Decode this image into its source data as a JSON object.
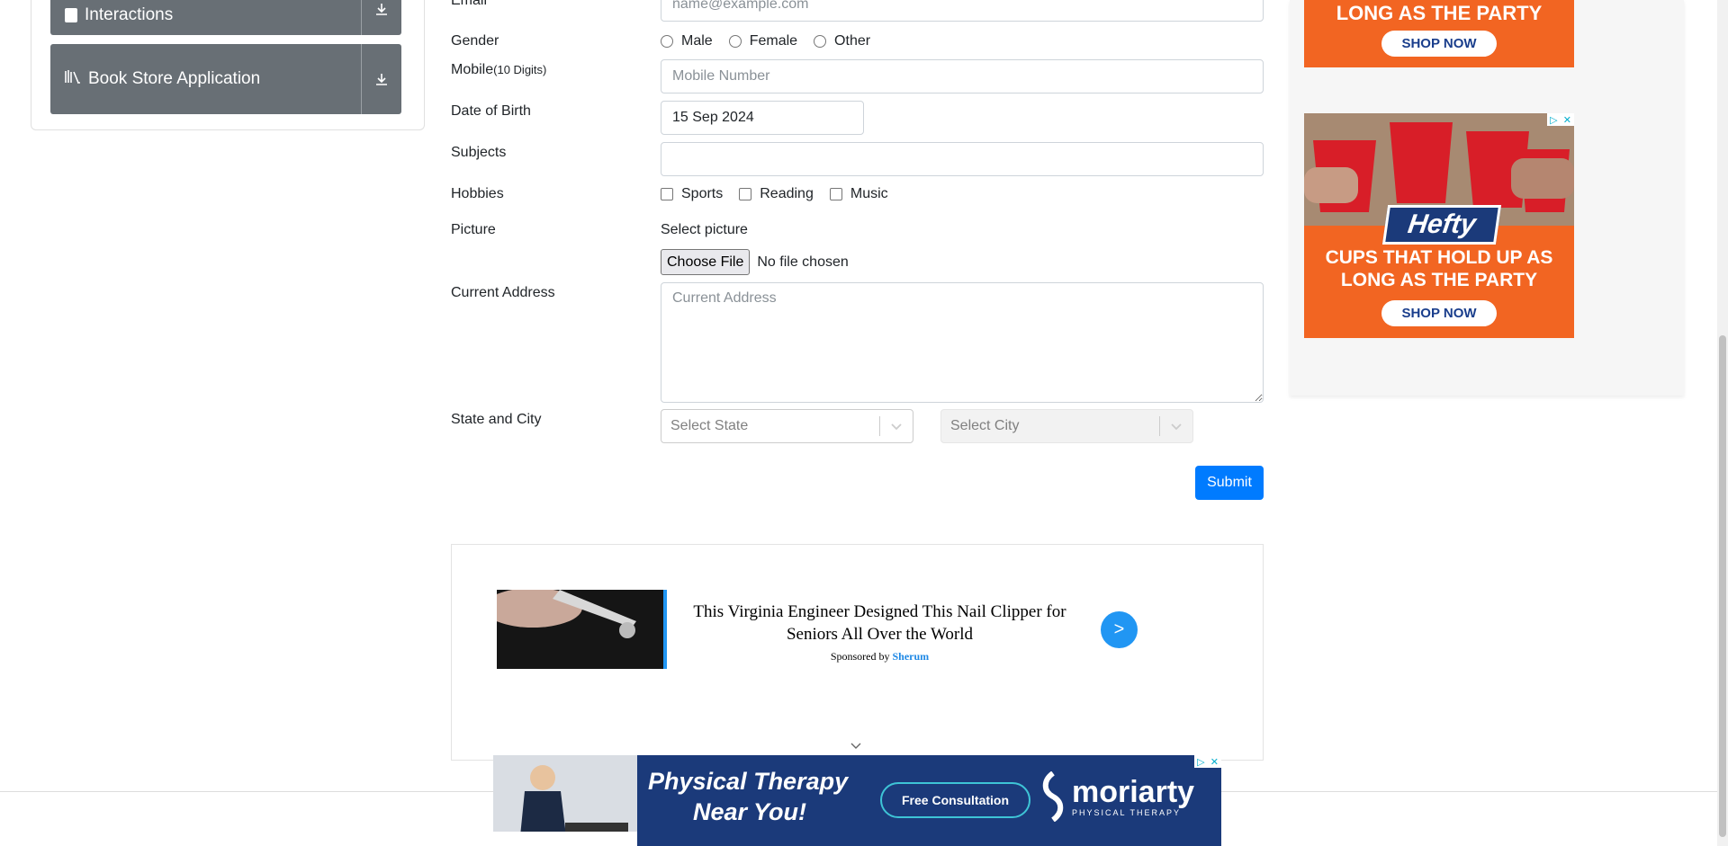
{
  "sidebar": {
    "items": [
      {
        "label": "Interactions",
        "icon": "interactions-icon"
      },
      {
        "label": "Book Store Application",
        "icon": "books-icon"
      }
    ]
  },
  "form": {
    "email_label": "Email",
    "email_placeholder": "name@example.com",
    "gender_label": "Gender",
    "gender_options": [
      "Male",
      "Female",
      "Other"
    ],
    "mobile_label": "Mobile",
    "mobile_hint": "(10 Digits)",
    "mobile_placeholder": "Mobile Number",
    "dob_label": "Date of Birth",
    "dob_value": "15 Sep 2024",
    "subjects_label": "Subjects",
    "hobbies_label": "Hobbies",
    "hobbies_options": [
      "Sports",
      "Reading",
      "Music"
    ],
    "picture_label": "Picture",
    "picture_select_label": "Select picture",
    "choose_file_label": "Choose File",
    "no_file_label": "No file chosen",
    "address_label": "Current Address",
    "address_placeholder": "Current Address",
    "state_city_label": "State and City",
    "state_placeholder": "Select State",
    "city_placeholder": "Select City",
    "submit_label": "Submit"
  },
  "ads": {
    "top_right_text": "LONG AS THE PARTY",
    "shop_now": "SHOP NOW",
    "hefty_brand": "Hefty",
    "hefty_tagline": "CUPS THAT HOLD UP AS LONG AS THE PARTY",
    "promo_title": "This Virginia Engineer Designed This Nail Clipper for Seniors All Over the World",
    "promo_sponsored": "Sponsored by",
    "promo_sponsor": "Sherum",
    "promo_arrow": ">",
    "bottom_title_line1": "Physical Therapy",
    "bottom_title_line2": "Near You!",
    "bottom_cta": "Free Consultation",
    "bottom_brand": "moriarty",
    "bottom_brand_sub": "PHYSICAL THERAPY"
  },
  "colors": {
    "sidebar_bg": "#686f75",
    "primary": "#007bff",
    "ad_orange": "#f26522",
    "ad_navy": "#1b3a7a"
  }
}
